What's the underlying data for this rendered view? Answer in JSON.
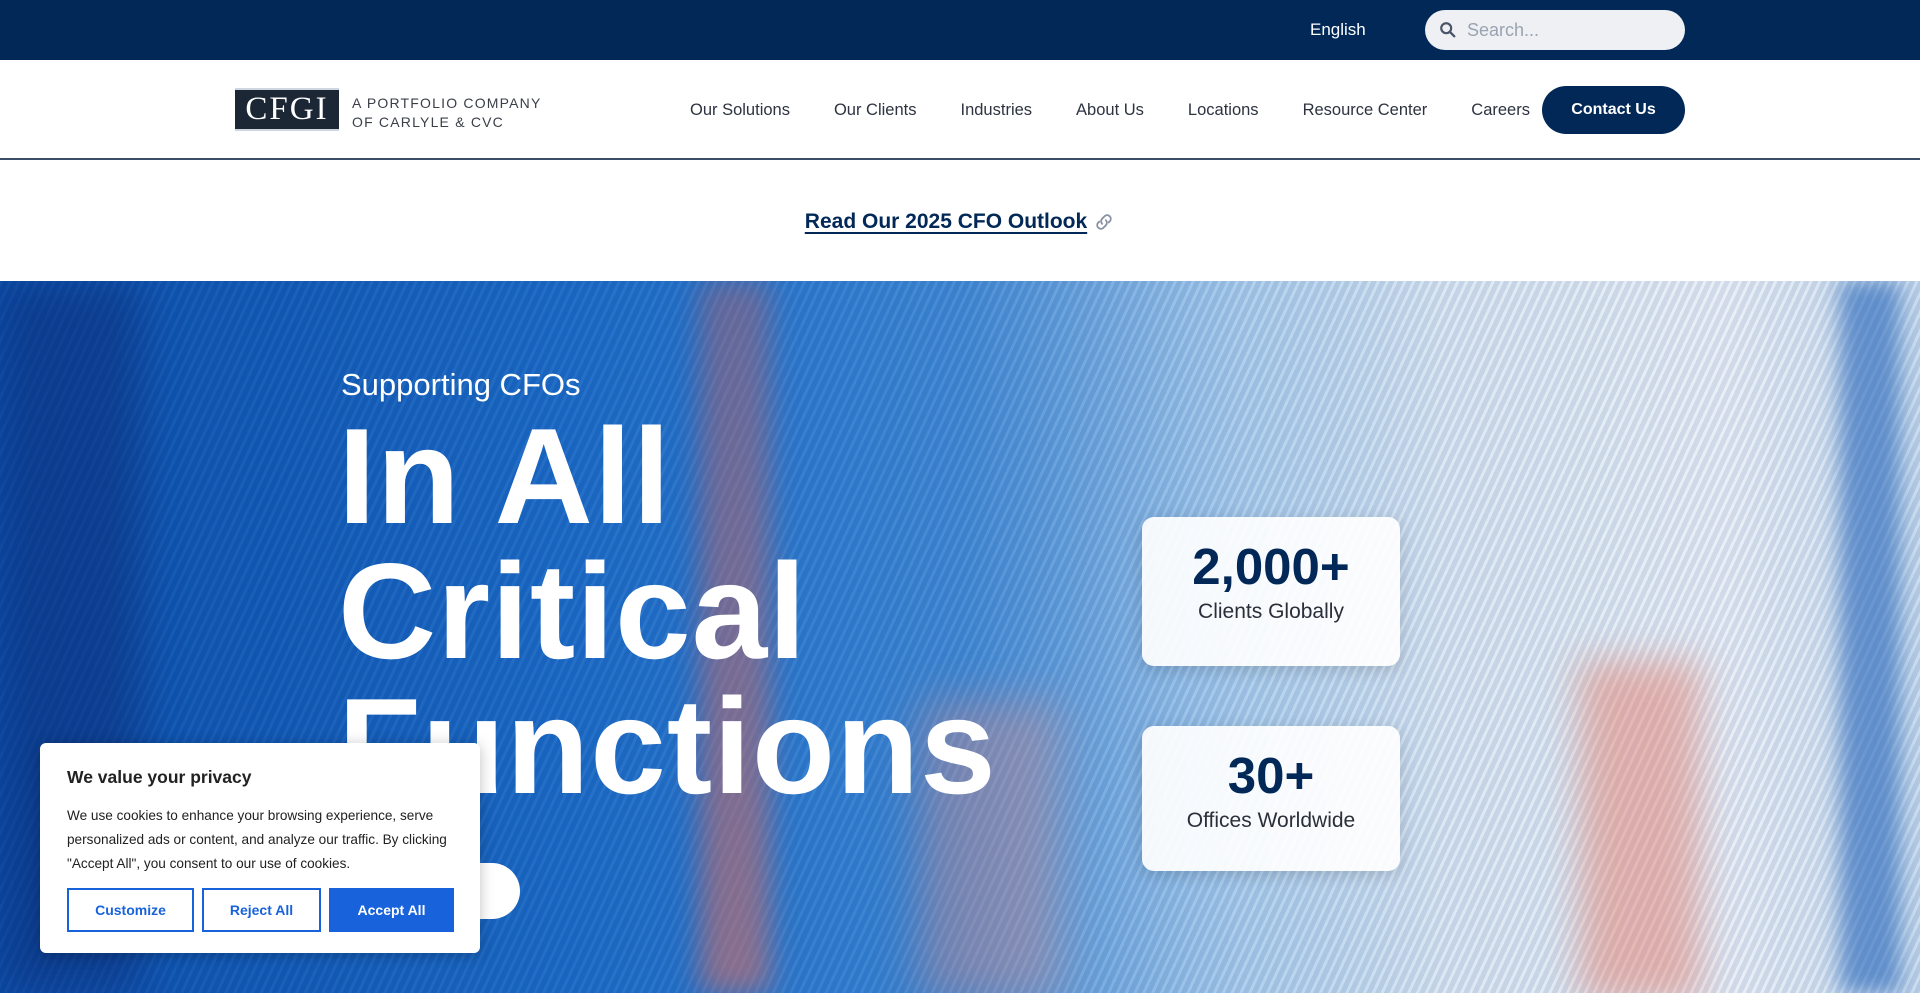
{
  "topbar": {
    "language": "English",
    "search_placeholder": "Search..."
  },
  "header": {
    "logo_text": "CFGI",
    "tagline_line1": "A PORTFOLIO COMPANY",
    "tagline_line2": "OF CARLYLE & CVC",
    "nav": [
      "Our Solutions",
      "Our Clients",
      "Industries",
      "About Us",
      "Locations",
      "Resource Center",
      "Careers"
    ],
    "contact_label": "Contact Us"
  },
  "announcement": {
    "link_text": "Read Our 2025 CFO Outlook"
  },
  "hero": {
    "kicker": "Supporting CFOs",
    "headline_line1": "In All",
    "headline_line2": "Critical",
    "headline_line3": "Functions",
    "stats": [
      {
        "value": "2,000+",
        "label": "Clients Globally"
      },
      {
        "value": "30+",
        "label": "Offices Worldwide"
      }
    ]
  },
  "cookie": {
    "title": "We value your privacy",
    "body": "We use cookies to enhance your browsing experience, serve personalized ads or content, and analyze our traffic. By clicking \"Accept All\", you consent to our use of cookies.",
    "customize": "Customize",
    "reject": "Reject All",
    "accept": "Accept All"
  },
  "colors": {
    "brand_navy": "#012856",
    "cookie_blue": "#1863dc"
  }
}
